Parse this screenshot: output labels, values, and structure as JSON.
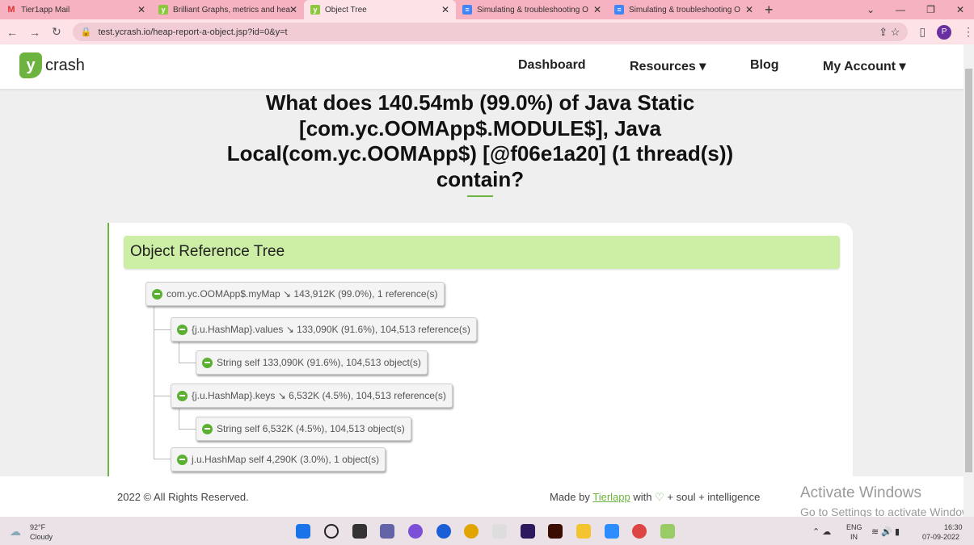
{
  "browser": {
    "tabs": [
      {
        "label": "Tier1app Mail"
      },
      {
        "label": "Brilliant Graphs, metrics and hea"
      },
      {
        "label": "Object Tree"
      },
      {
        "label": "Simulating & troubleshooting O"
      },
      {
        "label": "Simulating & troubleshooting O"
      }
    ],
    "url": "test.ycrash.io/heap-report-a-object.jsp?id=0&y=t",
    "profile": "P"
  },
  "header": {
    "logo_mark": "y",
    "logo_text": "crash",
    "nav": [
      "Dashboard",
      "Resources ▾",
      "Blog",
      "My Account ▾"
    ]
  },
  "main": {
    "title": "What does 140.54mb (99.0%) of Java Static [com.yc.OOMApp$.MODULE$], Java Local(com.yc.OOMApp$) [@f06e1a20] (1 thread(s)) contain?",
    "card_title": "Object Reference Tree",
    "tree": [
      {
        "text": "com.yc.OOMApp$.myMap ↘ 143,912K (99.0%), 1 reference(s)"
      },
      {
        "text": "{j.u.HashMap}.values ↘ 133,090K (91.6%), 104,513 reference(s)"
      },
      {
        "text": "String self 133,090K (91.6%), 104,513 object(s)"
      },
      {
        "text": "{j.u.HashMap}.keys ↘ 6,532K (4.5%), 104,513 reference(s)"
      },
      {
        "text": "String self 6,532K (4.5%), 104,513 object(s)"
      },
      {
        "text": "j.u.HashMap self 4,290K (3.0%), 1 object(s)"
      }
    ]
  },
  "footer": {
    "copyright": "2022 © All Rights Reserved.",
    "made_by": "Made by",
    "company": "Tierlapp",
    "with": "with",
    "tail": "+ soul + intelligence"
  },
  "watermark": {
    "line1": "Activate Windows",
    "line2": "Go to Settings to activate Windows."
  },
  "taskbar": {
    "temp": "92°F",
    "weather": "Cloudy",
    "lang1": "ENG",
    "lang2": "IN",
    "time": "16:30",
    "date": "07-09-2022"
  }
}
